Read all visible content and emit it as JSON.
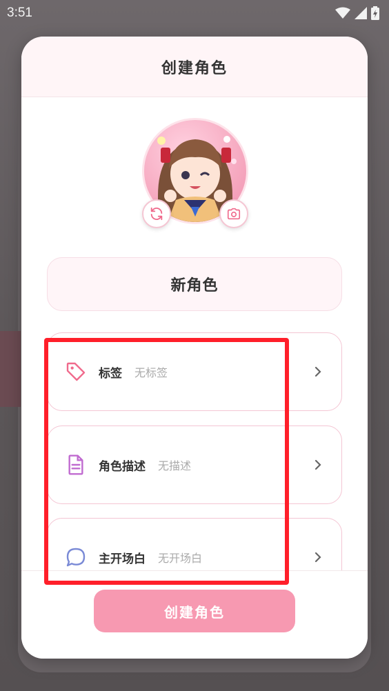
{
  "status_bar": {
    "time": "3:51"
  },
  "dialog": {
    "title": "创建角色"
  },
  "character": {
    "name": "新角色"
  },
  "rows": [
    {
      "label": "标签",
      "value": "无标签",
      "icon": "tag-icon"
    },
    {
      "label": "角色描述",
      "value": "无描述",
      "icon": "document-icon"
    },
    {
      "label": "主开场白",
      "value": "无开场白",
      "icon": "chat-bubble-icon"
    }
  ],
  "footer": {
    "create_label": "创建角色"
  },
  "colors": {
    "accent": "#f799b1",
    "highlight": "#ff1f2a",
    "tag_icon": "#f06a8c",
    "document_icon": "#c06bd0",
    "chat_icon": "#7a8ad6"
  }
}
